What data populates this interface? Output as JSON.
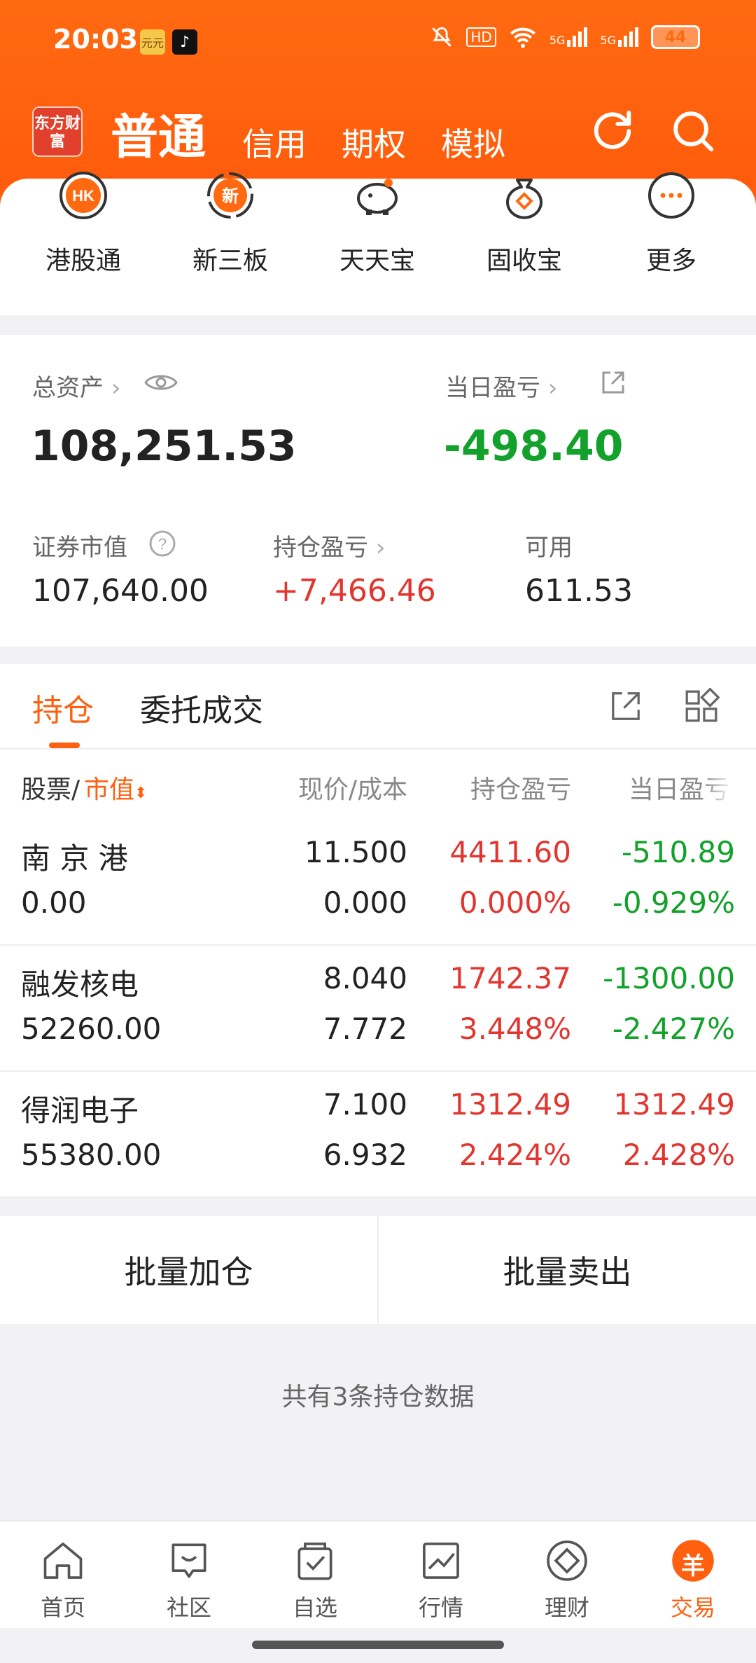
{
  "status_bar": {
    "time": "20:03",
    "app_badge_1": "元元",
    "app_badge_2": "♪",
    "network_1": "HD",
    "network_2": "5G",
    "network_3": "5G",
    "battery": "44"
  },
  "top_nav": {
    "logo": "东方财富",
    "tabs": [
      {
        "label": "普通",
        "active": true
      },
      {
        "label": "信用"
      },
      {
        "label": "期权"
      },
      {
        "label": "模拟"
      }
    ]
  },
  "quick_entries": [
    {
      "label": "港股通",
      "icon": "hk-icon",
      "glyph": "HK"
    },
    {
      "label": "新三板",
      "icon": "new-board-icon",
      "glyph": "新"
    },
    {
      "label": "天天宝",
      "icon": "piggy-bank-icon",
      "glyph": ""
    },
    {
      "label": "固收宝",
      "icon": "money-bag-icon",
      "glyph": ""
    },
    {
      "label": "更多",
      "icon": "more-icon",
      "glyph": "···"
    }
  ],
  "assets": {
    "total_label": "总资产",
    "total_value": "108,251.53",
    "daily_pl_label": "当日盈亏",
    "daily_pl_value": "-498.40",
    "market_value_label": "证券市值",
    "market_value": "107,640.00",
    "position_pl_label": "持仓盈亏",
    "position_pl_value": "+7,466.46",
    "available_label": "可用",
    "available_value": "611.53"
  },
  "holdings": {
    "tabs": [
      "持仓",
      "委托成交"
    ],
    "header": {
      "stock": "股票/",
      "market_value": "市值",
      "price_cost": "现价/成本",
      "position_pl": "持仓盈亏",
      "daily_pl": "当日盈亏"
    },
    "rows": [
      {
        "name": "南 京 港",
        "market_value": "0.00",
        "price": "11.500",
        "cost": "0.000",
        "pl": "4411.60",
        "pl_pct": "0.000%",
        "daily": "-510.89",
        "daily_pct": "-0.929%"
      },
      {
        "name": "融发核电",
        "market_value": "52260.00",
        "price": "8.040",
        "cost": "7.772",
        "pl": "1742.37",
        "pl_pct": "3.448%",
        "daily": "-1300.00",
        "daily_pct": "-2.427%"
      },
      {
        "name": "得润电子",
        "market_value": "55380.00",
        "price": "7.100",
        "cost": "6.932",
        "pl": "1312.49",
        "pl_pct": "2.424%",
        "daily": "1312.49",
        "daily_pct": "2.428%"
      }
    ]
  },
  "batch": {
    "add": "批量加仓",
    "sell": "批量卖出"
  },
  "footer_note": "共有3条持仓数据",
  "bottom_nav": [
    {
      "label": "首页",
      "icon": "home-icon"
    },
    {
      "label": "社区",
      "icon": "community-icon"
    },
    {
      "label": "自选",
      "icon": "watchlist-icon"
    },
    {
      "label": "行情",
      "icon": "market-icon"
    },
    {
      "label": "理财",
      "icon": "wealth-icon"
    },
    {
      "label": "交易",
      "icon": "trade-icon",
      "active": true,
      "glyph": "羊"
    }
  ],
  "colors": {
    "accent": "#ff6010",
    "up": "#e2352f",
    "down": "#12a12b"
  }
}
